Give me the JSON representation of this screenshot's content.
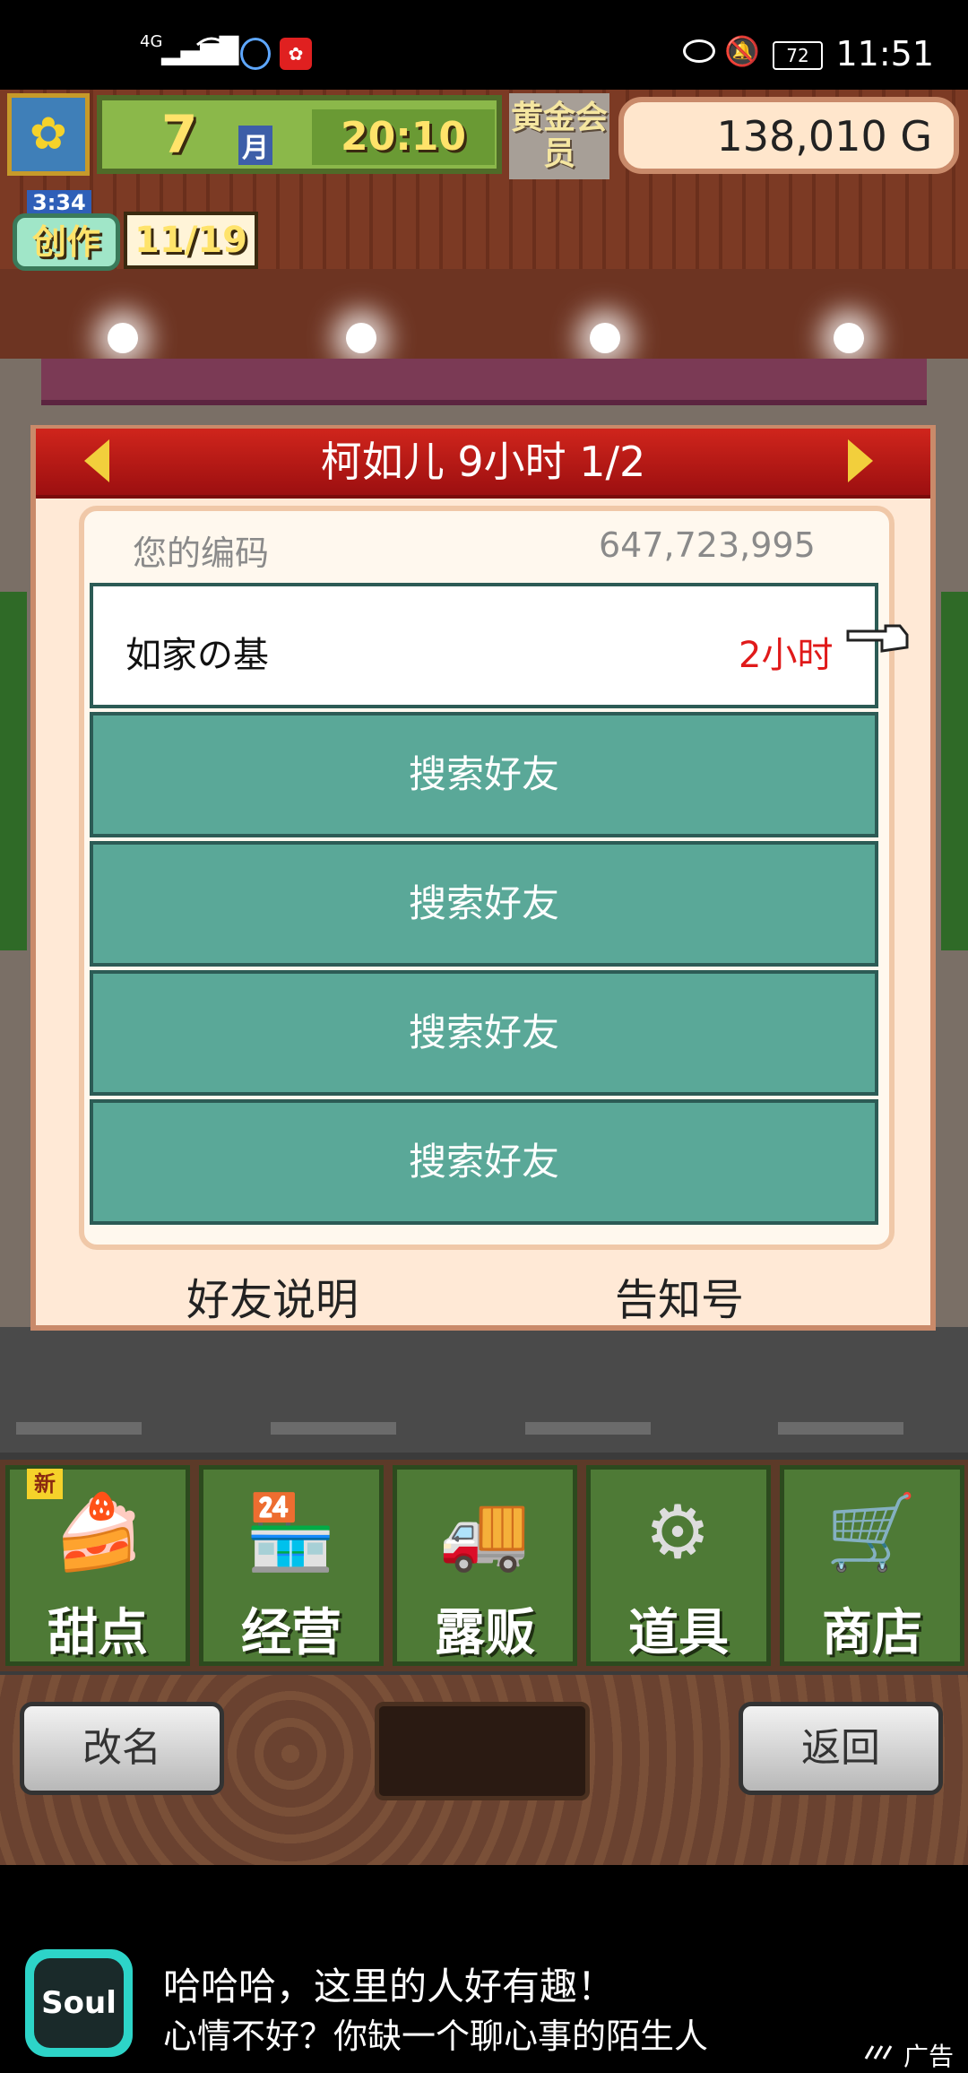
{
  "status_bar": {
    "network": "4G",
    "battery": "72",
    "time": "11:51"
  },
  "hud": {
    "month": "7",
    "month_label": "月",
    "clock": "20:10",
    "gold_member": "黄金会员",
    "money": "138,010 G",
    "create_timer": "3:34",
    "create_label": "创作",
    "create_count": "11/19"
  },
  "dialog": {
    "title": "柯如儿  9小时 1/2",
    "code_label": "您的编码",
    "code_value": "647,723,995",
    "friend_row": {
      "name": "如家の基",
      "time": "2小时"
    },
    "search_rows": [
      "搜索好友",
      "搜索好友",
      "搜索好友",
      "搜索好友"
    ],
    "link_left": "好友说明",
    "link_right": "告知号"
  },
  "menu": {
    "new_badge": "新",
    "items": [
      {
        "label": "甜点",
        "icon": "cake-icon",
        "glyph": "🍰"
      },
      {
        "label": "经营",
        "icon": "shop-icon",
        "glyph": "🏪"
      },
      {
        "label": "露贩",
        "icon": "food-truck-icon",
        "glyph": "🚚"
      },
      {
        "label": "道具",
        "icon": "tools-bag-icon",
        "glyph": "⚙"
      },
      {
        "label": "商店",
        "icon": "cart-icon",
        "glyph": "🛒"
      }
    ]
  },
  "bottom": {
    "rename_label": "改名",
    "back_label": "返回"
  },
  "ad": {
    "logo_text": "Soul",
    "line1": "哈哈哈，这里的人好有趣！",
    "line2": "心情不好？你缺一个聊心事的陌生人",
    "tag": "广告"
  }
}
